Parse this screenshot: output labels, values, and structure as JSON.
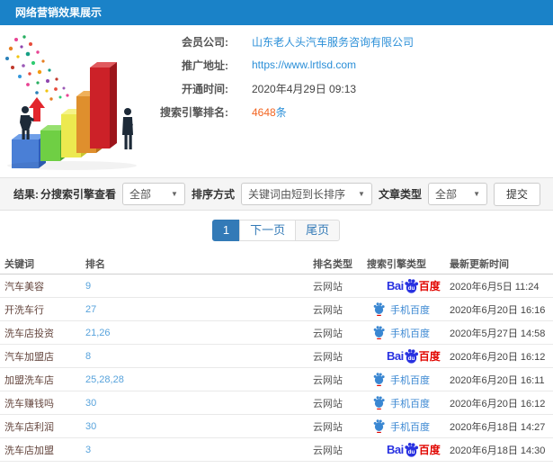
{
  "header": {
    "title": "网络营销效果展示"
  },
  "info": {
    "fields": [
      {
        "label": "会员公司:",
        "value": "山东老人头汽车服务咨询有限公司"
      },
      {
        "label": "推广地址:",
        "value": "https://www.lrtlsd.com"
      },
      {
        "label": "开通时间:",
        "value": "2020年4月29日 09:13"
      },
      {
        "label": "搜索引擎排名:",
        "value": "4648",
        "suffix": "条"
      }
    ]
  },
  "filters": {
    "result_label": "结果:",
    "engine_label": "分搜索引擎查看",
    "engine_value": "全部",
    "sort_label": "排序方式",
    "sort_value": "关键词由短到长排序",
    "article_label": "文章类型",
    "article_value": "全部",
    "submit_label": "提交"
  },
  "icons": {
    "dropdown_arrow": "▼"
  },
  "pagination": {
    "current": "1",
    "next": "下一页",
    "last": "尾页"
  },
  "logos": {
    "baidu": {
      "bai": "Bai",
      "du": "du",
      "cn": "百度"
    },
    "mobile_baidu": {
      "label": "手机百度"
    }
  },
  "table": {
    "headers": [
      "关键词",
      "排名",
      "排名类型",
      "搜索引擎类型",
      "最新更新时间"
    ],
    "rows": [
      {
        "keyword": "汽车美容",
        "rank": "9",
        "rank_type": "云网站",
        "engine": "baidu",
        "updated": "2020年6月5日 11:24"
      },
      {
        "keyword": "开洗车行",
        "rank": "27",
        "rank_type": "云网站",
        "engine": "mobile-baidu",
        "updated": "2020年6月20日 16:16"
      },
      {
        "keyword": "洗车店投资",
        "rank": "21,26",
        "rank_type": "云网站",
        "engine": "mobile-baidu",
        "updated": "2020年5月27日 14:58"
      },
      {
        "keyword": "汽车加盟店",
        "rank": "8",
        "rank_type": "云网站",
        "engine": "baidu",
        "updated": "2020年6月20日 16:12"
      },
      {
        "keyword": "加盟洗车店",
        "rank": "25,28,28",
        "rank_type": "云网站",
        "engine": "mobile-baidu",
        "updated": "2020年6月20日 16:11"
      },
      {
        "keyword": "洗车赚钱吗",
        "rank": "30",
        "rank_type": "云网站",
        "engine": "mobile-baidu",
        "updated": "2020年6月20日 16:12"
      },
      {
        "keyword": "洗车店利润",
        "rank": "30",
        "rank_type": "云网站",
        "engine": "mobile-baidu",
        "updated": "2020年6月18日 14:27"
      },
      {
        "keyword": "洗车店加盟",
        "rank": "3",
        "rank_type": "云网站",
        "engine": "baidu",
        "updated": "2020年6月18日 14:30"
      }
    ]
  },
  "colors": {
    "header_bg": "#1a82c8",
    "link_blue": "#2b8fd8",
    "rank_blue": "#58a3dc",
    "highlight_orange": "#f26522",
    "keyword_brown": "#63443c",
    "pagination_blue": "#337ab7",
    "baidu_blue": "#2932e1",
    "baidu_red": "#e10601",
    "mobile_baidu_blue": "#3a87d2"
  }
}
